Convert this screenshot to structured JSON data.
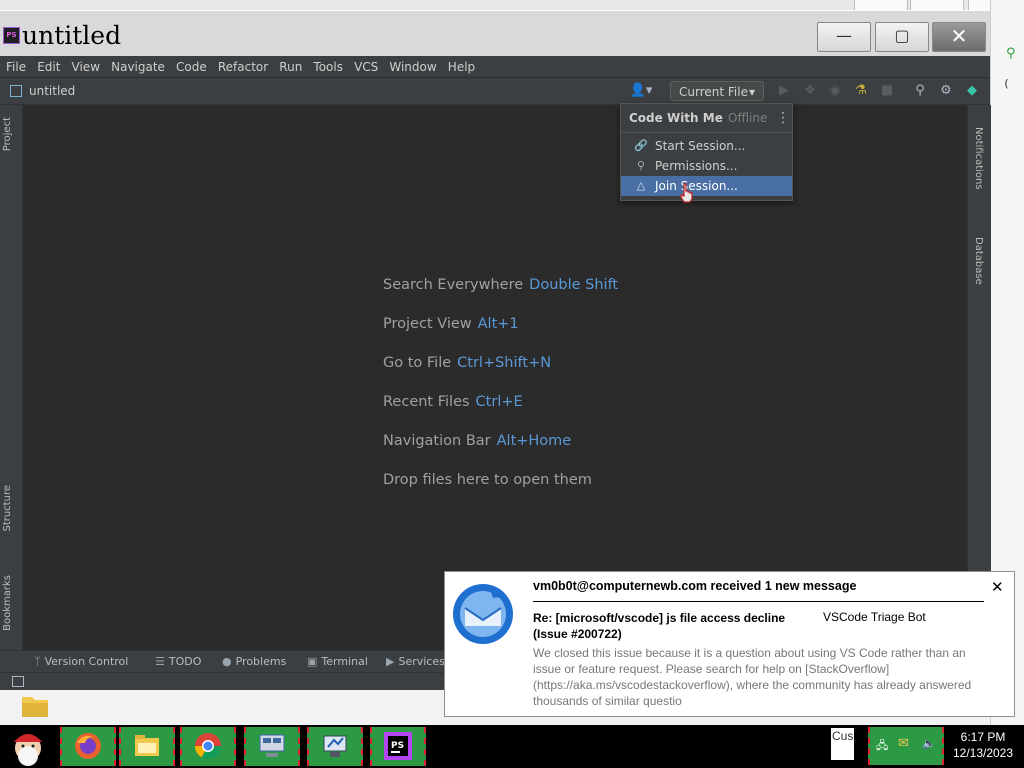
{
  "window": {
    "title": "untitled",
    "logo": "PS",
    "minimize_icon": "minimize-icon",
    "maximize_icon": "maximize-icon",
    "close_icon": "close-icon"
  },
  "menu": [
    "File",
    "Edit",
    "View",
    "Navigate",
    "Code",
    "Refactor",
    "Run",
    "Tools",
    "VCS",
    "Window",
    "Help"
  ],
  "navbar": {
    "project": "untitled",
    "run_config": "Current File"
  },
  "side_tabs": {
    "left": [
      "Project",
      "Structure",
      "Bookmarks"
    ],
    "right": [
      "Notifications",
      "Database"
    ]
  },
  "editor_hints": [
    {
      "text": "Search Everywhere",
      "key": "Double Shift"
    },
    {
      "text": "Project View",
      "key": "Alt+1"
    },
    {
      "text": "Go to File",
      "key": "Ctrl+Shift+N"
    },
    {
      "text": "Recent Files",
      "key": "Ctrl+E"
    },
    {
      "text": "Navigation Bar",
      "key": "Alt+Home"
    },
    {
      "text": "Drop files here to open them",
      "key": ""
    }
  ],
  "code_with_me": {
    "title": "Code With Me",
    "status": "Offline",
    "items": [
      {
        "label": "Start Session...",
        "icon": "link-icon"
      },
      {
        "label": "Permissions...",
        "icon": "key-icon"
      },
      {
        "label": "Join Session...",
        "icon": "join-icon",
        "selected": true
      }
    ]
  },
  "bottom_tabs": [
    {
      "label": "Version Control",
      "icon": "branch-icon"
    },
    {
      "label": "TODO",
      "icon": "list-icon"
    },
    {
      "label": "Problems",
      "icon": "info-icon"
    },
    {
      "label": "Terminal",
      "icon": "terminal-icon"
    },
    {
      "label": "Services",
      "icon": "play-icon"
    }
  ],
  "notification": {
    "title": "vm0b0t@computernewb.com received 1 new message",
    "subject": "Re: [microsoft/vscode] js file access decline (Issue #200722)",
    "sender": "VSCode Triage Bot",
    "body": "We closed this issue because it is a question about using VS Code rather than an issue or feature request. Please search for help on [StackOverflow](https://aka.ms/vscodestackoverflow), where the community has already answered thousands of similar questio"
  },
  "taskbar": {
    "apps": [
      "firefox-icon",
      "file-manager-icon",
      "chrome-icon",
      "network-icon",
      "system-icon",
      "phpstorm-icon"
    ],
    "input_text": "Cus",
    "clock_time": "6:17 PM",
    "clock_date": "12/13/2023"
  },
  "colors": {
    "editor_bg": "#2b2b2b",
    "chrome_bg": "#3c3f41",
    "key_blue": "#5b98d6",
    "selection": "#4a6fa5",
    "taskbar_green": "#2c9a45"
  }
}
